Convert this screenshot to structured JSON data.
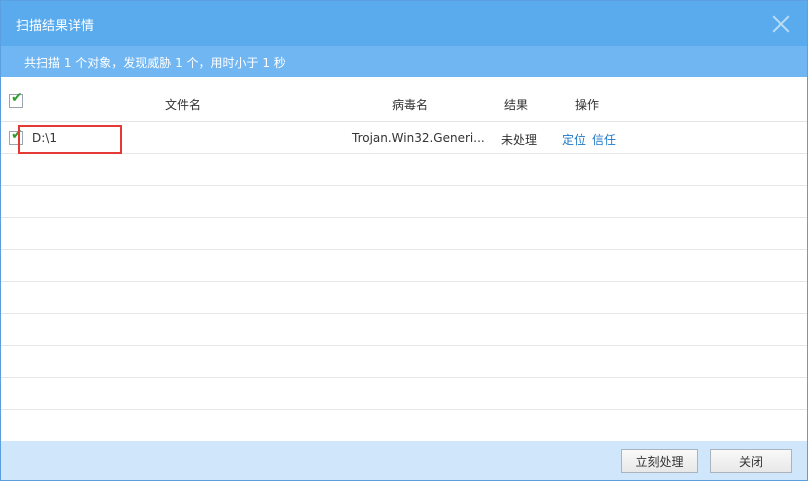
{
  "window": {
    "title": "扫描结果详情"
  },
  "summary": {
    "text": "共扫描 1 个对象，发现威胁 1 个，用时小于 1 秒"
  },
  "table": {
    "headers": {
      "filename": "文件名",
      "virus": "病毒名",
      "result": "结果",
      "action": "操作"
    },
    "rows": [
      {
        "checked": true,
        "filename": "D:\\1",
        "virus": "Trojan.Win32.Generi...",
        "result": "未处理",
        "actions": [
          "定位",
          "信任"
        ]
      }
    ]
  },
  "buttons": {
    "process_now": "立刻处理",
    "close": "关闭"
  },
  "colors": {
    "titlebar": "#5aabee",
    "summary": "#6fb6f3",
    "link": "#1e78c8",
    "highlight": "#e53935"
  }
}
